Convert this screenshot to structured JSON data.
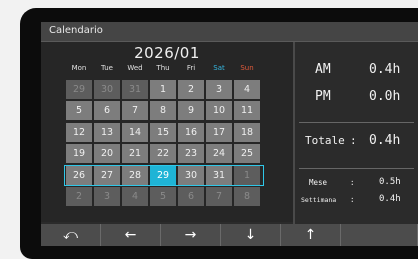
{
  "window": {
    "title": "Calendario"
  },
  "calendar": {
    "month_label": "2026/01",
    "weekdays": [
      {
        "label": "Mon",
        "type": "weekday"
      },
      {
        "label": "Tue",
        "type": "weekday"
      },
      {
        "label": "Wed",
        "type": "weekday"
      },
      {
        "label": "Thu",
        "type": "weekday"
      },
      {
        "label": "Fri",
        "type": "weekday"
      },
      {
        "label": "Sat",
        "type": "sat"
      },
      {
        "label": "Sun",
        "type": "sun"
      }
    ],
    "weeks": [
      [
        "29",
        "30",
        "31",
        "1",
        "2",
        "3",
        "4"
      ],
      [
        "5",
        "6",
        "7",
        "8",
        "9",
        "10",
        "11"
      ],
      [
        "12",
        "13",
        "14",
        "15",
        "16",
        "17",
        "18"
      ],
      [
        "19",
        "20",
        "21",
        "22",
        "23",
        "24",
        "25"
      ],
      [
        "26",
        "27",
        "28",
        "29",
        "30",
        "31",
        "1"
      ],
      [
        "2",
        "3",
        "4",
        "5",
        "6",
        "7",
        "8"
      ]
    ],
    "faded_cells": [
      [
        0,
        0
      ],
      [
        0,
        1
      ],
      [
        0,
        2
      ],
      [
        4,
        6
      ],
      [
        5,
        0
      ],
      [
        5,
        1
      ],
      [
        5,
        2
      ],
      [
        5,
        3
      ],
      [
        5,
        4
      ],
      [
        5,
        5
      ],
      [
        5,
        6
      ]
    ],
    "selected": {
      "week": 4,
      "day": 3
    },
    "highlighted_week": 4,
    "colors": {
      "today": "#1fb4d6",
      "week_border": "#2fc7e8",
      "sat": "#35b6e0",
      "sun": "#e05a3a"
    }
  },
  "stats": {
    "am_label": "AM",
    "am_value": "0.4h",
    "pm_label": "PM",
    "pm_value": "0.0h",
    "total_label": "Totale",
    "total_colon": ":",
    "total_value": "0.4h",
    "month_label": "Mese",
    "month_colon": ":",
    "month_value": "0.5h",
    "week_label": "Settimana",
    "week_colon": ":",
    "week_value": "0.4h"
  },
  "toolbar": {
    "buttons": [
      {
        "icon": "back-icon",
        "glyph": "⤺"
      },
      {
        "icon": "arrow-left-icon",
        "glyph": "←"
      },
      {
        "icon": "arrow-right-icon",
        "glyph": "→"
      },
      {
        "icon": "arrow-down-icon",
        "glyph": "↓"
      },
      {
        "icon": "arrow-up-icon",
        "glyph": "↑"
      },
      {
        "icon": "blank",
        "glyph": ""
      }
    ]
  }
}
